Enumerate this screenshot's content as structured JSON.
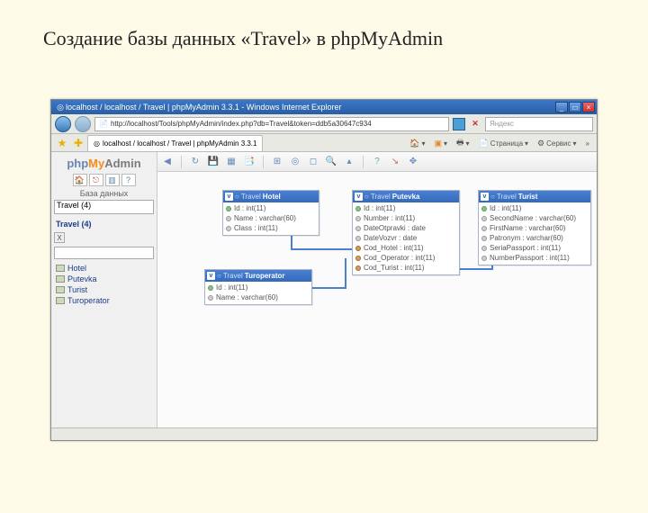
{
  "slide_title": "Создание  базы данных «Travel» в phpMyAdmin",
  "window": {
    "title": "localhost / localhost / Travel | phpMyAdmin 3.3.1 - Windows Internet Explorer",
    "min": "_",
    "max": "▭",
    "close": "×"
  },
  "addressbar": {
    "url": "http://localhost/Tools/phpMyAdmin/index.php?db=Travel&token=ddb5a30647c934",
    "search_placeholder": "Яндекс"
  },
  "tab": {
    "title": "localhost / localhost / Travel | phpMyAdmin 3.3.1"
  },
  "tbbtns": {
    "page": "Страница",
    "service": "Сервис"
  },
  "sidebar": {
    "logo_php": "php",
    "logo_my": "My",
    "logo_admin": "Admin",
    "db_label": "База данных",
    "db_select": "Travel (4)",
    "db_link": "Travel (4)",
    "x": "X",
    "tables": [
      "Hotel",
      "Putevka",
      "Turist",
      "Turoperator"
    ]
  },
  "tables": {
    "hotel": {
      "db": "Travel",
      "name": "Hotel",
      "fields": [
        {
          "txt": "Id : int(11)",
          "key": true
        },
        {
          "txt": "Name : varchar(60)"
        },
        {
          "txt": "Class : int(11)"
        }
      ]
    },
    "turoperator": {
      "db": "Travel",
      "name": "Turoperator",
      "fields": [
        {
          "txt": "Id : int(11)",
          "key": true
        },
        {
          "txt": "Name : varchar(60)"
        }
      ]
    },
    "putevka": {
      "db": "Travel",
      "name": "Putevka",
      "fields": [
        {
          "txt": "Id : int(11)",
          "key": true
        },
        {
          "txt": "Number : int(11)"
        },
        {
          "txt": "DateOtpravki : date"
        },
        {
          "txt": "DateVozvr : date"
        },
        {
          "txt": "Cod_Hotel : int(11)",
          "fk": true
        },
        {
          "txt": "Cod_Operator : int(11)",
          "fk": true
        },
        {
          "txt": "Cod_Turist : int(11)",
          "fk": true
        }
      ]
    },
    "turist": {
      "db": "Travel",
      "name": "Turist",
      "fields": [
        {
          "txt": "Id : int(11)",
          "key": true
        },
        {
          "txt": "SecondName : varchar(60)"
        },
        {
          "txt": "FirstName : varchar(60)"
        },
        {
          "txt": "Patronym : varchar(60)"
        },
        {
          "txt": "SeriaPassport : int(11)"
        },
        {
          "txt": "NumberPassport : int(11)"
        }
      ]
    }
  }
}
